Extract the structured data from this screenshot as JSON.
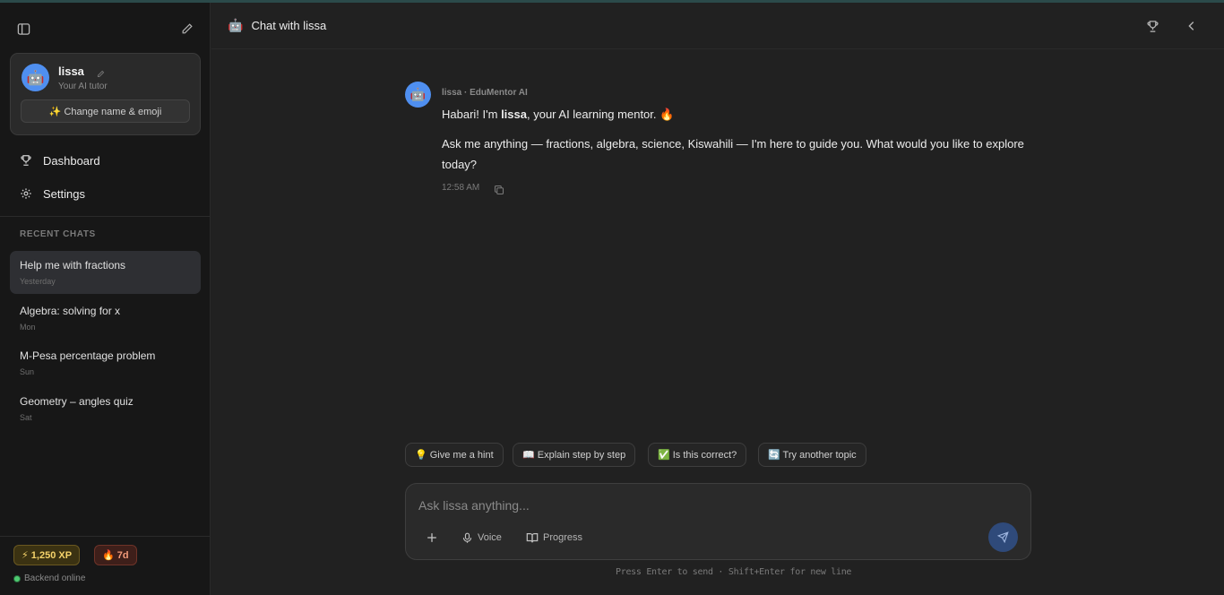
{
  "sidebar": {
    "profile": {
      "avatar_emoji": "🤖",
      "name": "lissa",
      "subtitle": "Your AI tutor",
      "change_button": "✨ Change name & emoji"
    },
    "nav": [
      {
        "label": "Dashboard",
        "icon": "trophy-icon"
      },
      {
        "label": "Settings",
        "icon": "gear-icon"
      }
    ],
    "recent_label": "RECENT CHATS",
    "recent_chats": [
      {
        "title": "Help me with fractions",
        "time": "Yesterday",
        "active": true
      },
      {
        "title": "Algebra: solving for x",
        "time": "Mon",
        "active": false
      },
      {
        "title": "M-Pesa percentage problem",
        "time": "Sun",
        "active": false
      },
      {
        "title": "Geometry – angles quiz",
        "time": "Sat",
        "active": false
      }
    ],
    "xp_badge": "⚡ 1,250 XP",
    "streak_badge": "🔥 7d",
    "backend_status": "Backend online"
  },
  "header": {
    "bot_emoji": "🤖",
    "title": "Chat with lissa"
  },
  "message": {
    "avatar_emoji": "🤖",
    "meta": "lissa · EduMentor AI",
    "line1_prefix": "Habari! I'm ",
    "line1_name": "lissa",
    "line1_suffix": ", your AI learning mentor. 🔥",
    "line2": "Ask me anything — fractions, algebra, science, Kiswahili — I'm here to guide you. What would you like to explore today?",
    "time": "12:58 AM"
  },
  "suggestions": [
    "💡 Give me a hint",
    "📖 Explain step by step",
    "✅ Is this correct?",
    "🔄 Try another topic"
  ],
  "composer": {
    "placeholder": "Ask lissa anything...",
    "voice_label": "Voice",
    "progress_label": "Progress"
  },
  "hint": "Press Enter to send · Shift+Enter for new line",
  "colors": {
    "background": "#212121",
    "sidebar": "#171717",
    "accent": "#4f8ff0",
    "online": "#4ecb71"
  }
}
